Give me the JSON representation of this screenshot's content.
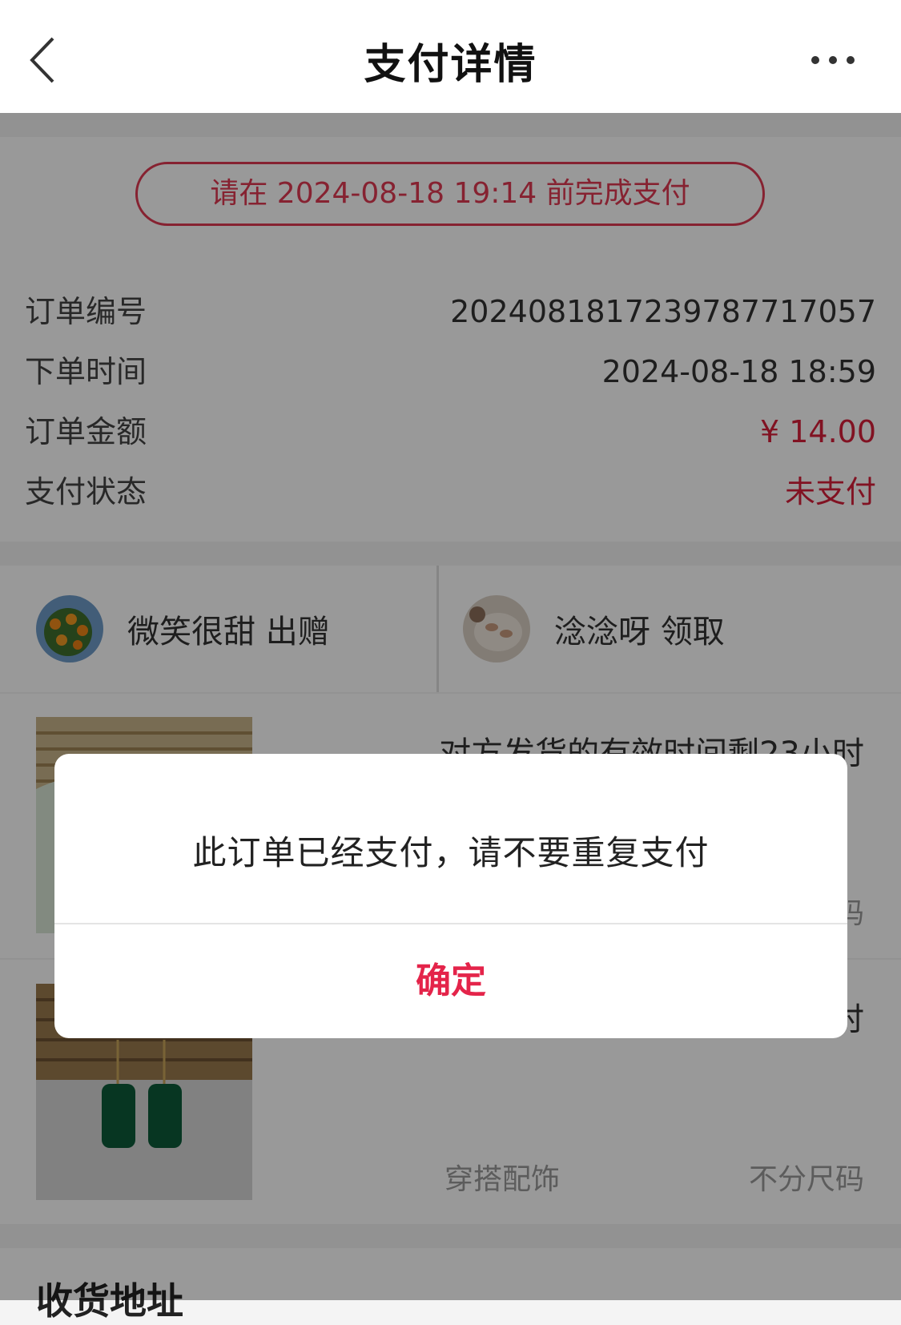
{
  "header": {
    "title": "支付详情",
    "back_icon": "chevron-left-icon",
    "more_icon": "more-horizontal-icon"
  },
  "deadline_notice": "请在 2024-08-18 19:14 前完成支付",
  "order": {
    "rows": [
      {
        "label": "订单编号",
        "value": "2024081817239787717057"
      },
      {
        "label": "下单时间",
        "value": "2024-08-18 18:59"
      },
      {
        "label": "订单金额",
        "value": "¥ 14.00"
      },
      {
        "label": "支付状态",
        "value": "未支付"
      }
    ]
  },
  "parties": {
    "giver": "微笑很甜 出赠",
    "receiver": "淰淰呀 领取"
  },
  "goods": [
    {
      "notice": "对方发货的有效时间剩23小时",
      "size_tail": "码"
    },
    {
      "notice_tail": "时",
      "category": "穿搭配饰",
      "size": "不分尺码"
    }
  ],
  "address_title": "收货地址",
  "dialog": {
    "message": "此订单已经支付，请不要重复支付",
    "confirm": "确定"
  },
  "colors": {
    "accent": "#e4244a",
    "price_red": "#d81e3a",
    "overlay": "rgba(0,0,0,0.40)"
  }
}
